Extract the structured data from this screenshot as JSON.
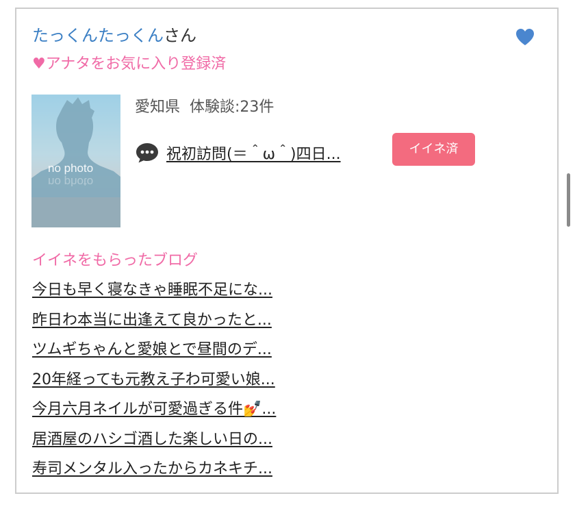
{
  "user": {
    "name": "たっくんたっくん",
    "suffix": "さん",
    "favorite_status": "♥アナタをお気に入り登録済",
    "favorite_icon": "heart-icon",
    "favorite_color": "#4a86cf"
  },
  "profile": {
    "avatar_text": "no photo",
    "prefecture": "愛知県",
    "review_count": "体験談:23件"
  },
  "latest_review": {
    "icon": "speech-bubble-icon",
    "title": "祝初訪問(＝＾ω＾)四日...",
    "like_button": "イイネ済",
    "like_color": "#f36b7f"
  },
  "liked_blogs": {
    "heading": "イイネをもらったブログ",
    "items": [
      "今日も早く寝なきゃ睡眠不足にな...",
      "昨日わ本当に出逢えて良かったと...",
      "ツムギちゃんと愛娘とで昼間のデ...",
      "20年経っても元教え子わ可愛い娘...",
      "今月六月ネイルが可愛過ぎる件💅...",
      "居酒屋のハシゴ酒した楽しい日の...",
      "寿司メンタル入ったからカネキチ..."
    ]
  },
  "colors": {
    "name_blue": "#3b7fc4",
    "accent_pink": "#f06aa6"
  }
}
